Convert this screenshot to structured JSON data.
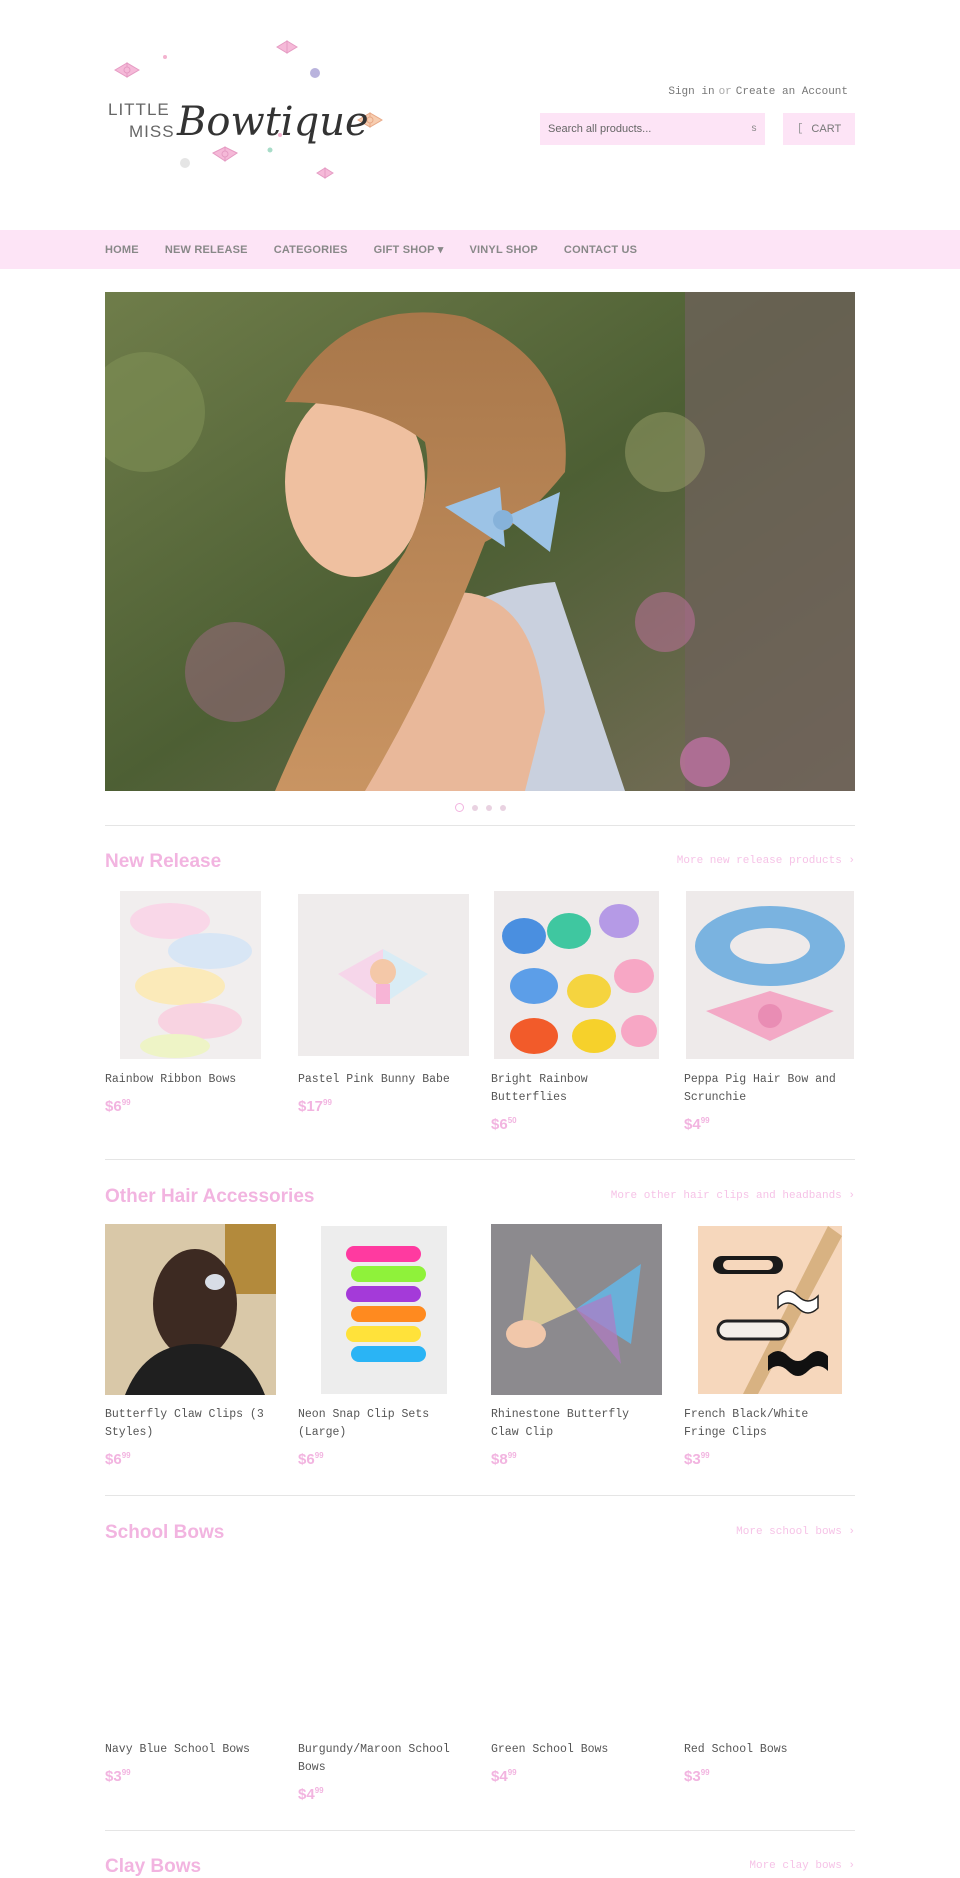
{
  "account": {
    "sign_in": "Sign in",
    "or": "or",
    "create": "Create an Account"
  },
  "search": {
    "placeholder": "Search all products...",
    "icon_glyph": "s"
  },
  "cart": {
    "label": "CART",
    "icon_glyph": "["
  },
  "nav": {
    "items": [
      {
        "label": "HOME"
      },
      {
        "label": "NEW RELEASE"
      },
      {
        "label": "CATEGORIES"
      },
      {
        "label": "GIFT SHOP ▾"
      },
      {
        "label": "VINYL SHOP"
      },
      {
        "label": "CONTACT US"
      }
    ]
  },
  "logo": {
    "line1": "LITTLE",
    "line2": "MISS",
    "script": "Bowtique"
  },
  "sections": [
    {
      "title": "New Release",
      "more": "More new release products ›",
      "products": [
        {
          "name": "Rainbow Ribbon Bows",
          "price": "$6",
          "cents": "99"
        },
        {
          "name": "Pastel Pink Bunny Babe",
          "price": "$17",
          "cents": "99"
        },
        {
          "name": "Bright Rainbow Butterflies",
          "price": "$6",
          "cents": "50"
        },
        {
          "name": "Peppa Pig Hair Bow and Scrunchie",
          "price": "$4",
          "cents": "99"
        }
      ]
    },
    {
      "title": "Other Hair Accessories",
      "more": "More other hair clips and headbands ›",
      "products": [
        {
          "name": "Butterfly Claw Clips (3 Styles)",
          "price": "$6",
          "cents": "99"
        },
        {
          "name": "Neon Snap Clip Sets (Large)",
          "price": "$6",
          "cents": "99"
        },
        {
          "name": "Rhinestone Butterfly Claw Clip",
          "price": "$8",
          "cents": "99"
        },
        {
          "name": "French Black/White Fringe Clips",
          "price": "$3",
          "cents": "99"
        }
      ]
    },
    {
      "title": "School Bows",
      "more": "More school bows ›",
      "products": [
        {
          "name": "Navy Blue School Bows",
          "price": "$3",
          "cents": "99"
        },
        {
          "name": "Burgundy/Maroon School Bows",
          "price": "$4",
          "cents": "99"
        },
        {
          "name": "Green School Bows",
          "price": "$4",
          "cents": "99"
        },
        {
          "name": "Red School Bows",
          "price": "$3",
          "cents": "99"
        }
      ]
    },
    {
      "title": "Clay Bows",
      "more": "More clay bows ›",
      "products": []
    }
  ],
  "colors": {
    "accent_pink": "#f2b4e0",
    "nav_bg": "#fde4f6"
  }
}
